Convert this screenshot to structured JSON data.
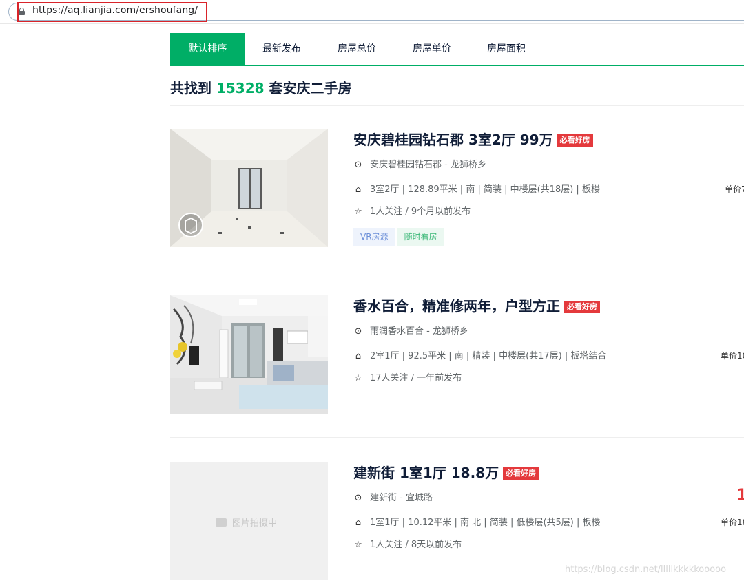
{
  "browser": {
    "url": "https://aq.lianjia.com/ershoufang/"
  },
  "sort_tabs": [
    {
      "label": "默认排序",
      "active": true
    },
    {
      "label": "最新发布",
      "active": false
    },
    {
      "label": "房屋总价",
      "active": false
    },
    {
      "label": "房屋单价",
      "active": false
    },
    {
      "label": "房屋面积",
      "active": false
    }
  ],
  "summary": {
    "prefix": "共找到 ",
    "count": "15328",
    "suffix": " 套安庆二手房"
  },
  "listings": [
    {
      "title": "安庆碧桂园钻石郡 3室2厅 99万",
      "badge": "必看好房",
      "location": "安庆碧桂园钻石郡 - 龙狮桥乡",
      "house_info": "3室2厅 | 128.89平米 | 南 | 简装 | 中楼层(共18层) | 板楼",
      "follow_info": "1人关注 / 9个月以前发布",
      "unit_price_partial": "单价7",
      "tags": [
        "VR房源",
        "随时看房"
      ],
      "image": "photo"
    },
    {
      "title": "香水百合，精准修两年，户型方正",
      "badge": "必看好房",
      "location": "雨润香水百合 - 龙狮桥乡",
      "house_info": "2室1厅 | 92.5平米 | 南 | 精装 | 中楼层(共17层) | 板塔结合",
      "follow_info": "17人关注 / 一年前发布",
      "unit_price_partial": "单价10",
      "tags": [],
      "image": "photo"
    },
    {
      "title": "建新街 1室1厅 18.8万",
      "badge": "必看好房",
      "location": "建新街 - 宜城路",
      "house_info": "1室1厅 | 10.12平米 | 南 北 | 简装 | 低楼层(共5层) | 板楼",
      "follow_info": "1人关注 / 8天以前发布",
      "unit_price_partial": "单价18",
      "total_price_partial": "1",
      "tags": [],
      "image_placeholder": "图片拍摄中"
    }
  ],
  "watermark": "https://blog.csdn.net/lllllkkkkkooooo",
  "colors": {
    "accent": "#00ae66",
    "badge": "#e4393c",
    "highlight_box": "#d9242a"
  }
}
